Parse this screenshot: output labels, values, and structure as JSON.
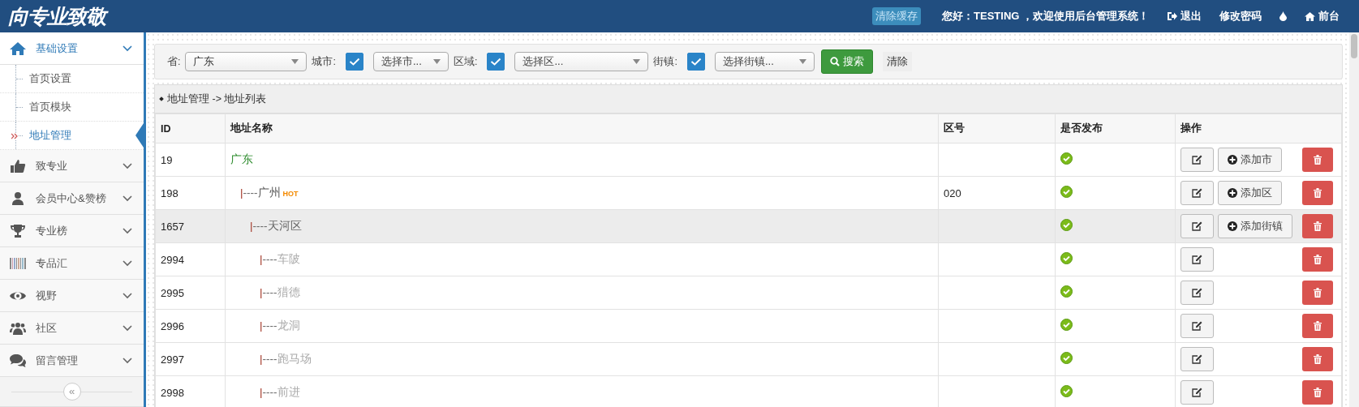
{
  "header": {
    "logo": "向专业致敬",
    "clear_cache": "清除缓存",
    "greeting": "您好：TESTING ，欢迎使用后台管理系统！",
    "links": [
      {
        "kind": "logout",
        "label": "退出"
      },
      {
        "kind": "text",
        "label": "修改密码"
      },
      {
        "kind": "drop"
      },
      {
        "kind": "home",
        "label": "前台"
      }
    ]
  },
  "sidebar": {
    "groups": [
      {
        "label": "基础设置",
        "expanded": true,
        "children": [
          {
            "label": "首页设置",
            "selected": false
          },
          {
            "label": "首页模块",
            "selected": false
          },
          {
            "label": "地址管理",
            "selected": true
          }
        ]
      },
      {
        "label": "致专业",
        "expanded": false
      },
      {
        "label": "会员中心&赞榜",
        "expanded": false
      },
      {
        "label": "专业榜",
        "expanded": false
      },
      {
        "label": "专品汇",
        "expanded": false
      },
      {
        "label": "视野",
        "expanded": false
      },
      {
        "label": "社区",
        "expanded": false
      },
      {
        "label": "留言管理",
        "expanded": false
      }
    ],
    "collapse_toggle": "«"
  },
  "filters": [
    {
      "kind": "select",
      "label": "省:",
      "value": "广东"
    },
    {
      "kind": "check-select",
      "label": "城市:",
      "checked": true,
      "placeholder": "选择市..."
    },
    {
      "kind": "check-select",
      "label": "区域:",
      "checked": true,
      "placeholder": "选择区..."
    },
    {
      "kind": "check-select",
      "label": "街镇:",
      "checked": true,
      "placeholder": "选择街镇..."
    }
  ],
  "search_button": "搜索",
  "clear_button": "清除",
  "breadcrumb": "地址管理 -> 地址列表",
  "table": {
    "columns": [
      "ID",
      "地址名称",
      "区号",
      "是否发布",
      "操作"
    ],
    "rows": [
      {
        "id": "19",
        "name": "广东",
        "published": true,
        "hovered": false,
        "add_label": "添加市",
        "children": [
          {
            "id": "198",
            "prefix": "|----",
            "name": "广州",
            "badge": "HOT",
            "code": "020",
            "published": true,
            "hovered": false,
            "add_label": "添加区",
            "children": [
              {
                "id": "1657",
                "prefix": "|----",
                "name": "天河区",
                "published": true,
                "hovered": true,
                "add_label": "添加街镇",
                "children": [
                  {
                    "id": "2994",
                    "prefix": "|----",
                    "name": "车陂",
                    "published": true,
                    "hovered": false
                  },
                  {
                    "id": "2995",
                    "prefix": "|----",
                    "name": "猎德",
                    "published": true,
                    "hovered": false
                  },
                  {
                    "id": "2996",
                    "prefix": "|----",
                    "name": "龙洞",
                    "published": true,
                    "hovered": false
                  },
                  {
                    "id": "2997",
                    "prefix": "|----",
                    "name": "跑马场",
                    "published": true,
                    "hovered": false
                  },
                  {
                    "id": "2998",
                    "prefix": "|----",
                    "name": "前进",
                    "published": true,
                    "hovered": false
                  }
                ]
              }
            ]
          }
        ]
      }
    ]
  }
}
